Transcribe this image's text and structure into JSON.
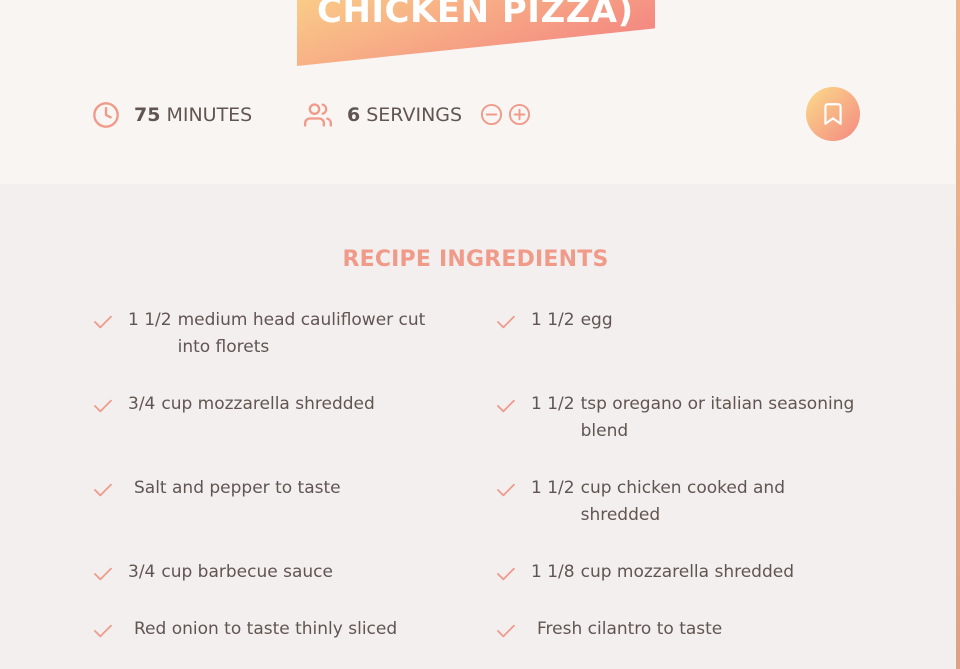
{
  "recipe": {
    "title": "CHICKEN PIZZA)"
  },
  "details": {
    "time_value": "75",
    "time_unit": "MINUTES",
    "servings_value": "6",
    "servings_unit": "SERVINGS"
  },
  "icons": {
    "clock": "clock-icon",
    "users": "users-icon",
    "minus": "minus-circle-icon",
    "plus": "plus-circle-icon",
    "bookmark": "bookmark-icon",
    "check": "check-icon"
  },
  "colors": {
    "accent": "#f09a8a",
    "gradient_start": "#fbdb89",
    "gradient_end": "#f48982",
    "text": "#615551",
    "top_bg": "#f9f5f3",
    "ingredients_bg": "#f2efee"
  },
  "ingredients": {
    "heading": "RECIPE INGREDIENTS",
    "items": [
      {
        "quantity": "1 1/2",
        "description_line1": "medium head cauliflower cut",
        "description_line2": "into florets"
      },
      {
        "quantity": "1 1/2",
        "description_line1": "egg",
        "description_line2": ""
      },
      {
        "quantity": "3/4",
        "description_line1": "cup mozzarella shredded",
        "description_line2": ""
      },
      {
        "quantity": "1 1/2",
        "description_line1": "tsp oregano or italian seasoning",
        "description_line2": "blend"
      },
      {
        "quantity": "",
        "description_line1": "Salt and pepper to taste",
        "description_line2": ""
      },
      {
        "quantity": "1 1/2",
        "description_line1": "cup chicken cooked and",
        "description_line2": "shredded"
      },
      {
        "quantity": "3/4",
        "description_line1": "cup barbecue sauce",
        "description_line2": ""
      },
      {
        "quantity": "1 1/8",
        "description_line1": "cup mozzarella shredded",
        "description_line2": ""
      },
      {
        "quantity": "",
        "description_line1": "Red onion to taste thinly sliced",
        "description_line2": ""
      },
      {
        "quantity": "",
        "description_line1": "Fresh cilantro to taste",
        "description_line2": ""
      }
    ]
  }
}
